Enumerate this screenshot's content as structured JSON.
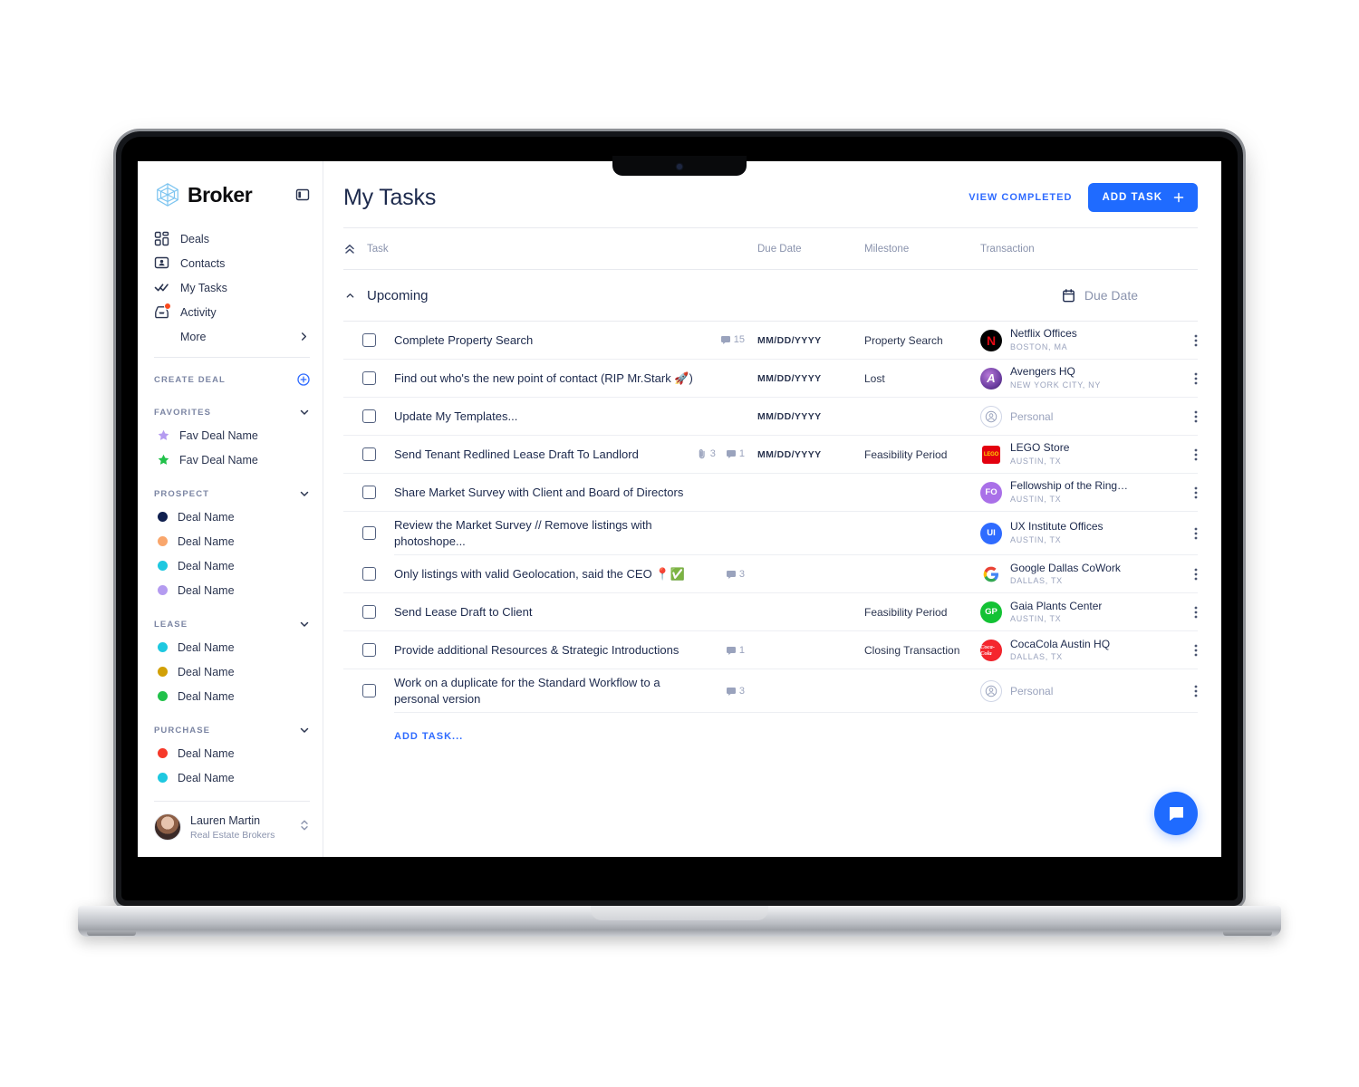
{
  "app": {
    "brand_name": "Broker",
    "logo_icon": "hexagon-cube-icon",
    "collapse_icon": "sidebar-collapse-icon"
  },
  "sidebar": {
    "nav": [
      {
        "label": "Deals",
        "icon": "grid-icon"
      },
      {
        "label": "Contacts",
        "icon": "contact-card-icon"
      },
      {
        "label": "My Tasks",
        "icon": "double-check-icon"
      },
      {
        "label": "Activity",
        "icon": "activity-inbox-icon",
        "badge": true
      },
      {
        "label": "More",
        "icon": "chevron-right-icon"
      }
    ],
    "sections": [
      {
        "label": "CREATE DEAL",
        "action_icon": "plus-circle-icon",
        "action_color": "#2f6bff",
        "items": []
      },
      {
        "label": "FAVORITES",
        "action_icon": "chevron-down-icon",
        "items": [
          {
            "label": "Fav Deal Name",
            "marker": "star",
            "color": "#b49bf0"
          },
          {
            "label": "Fav Deal Name",
            "marker": "star",
            "color": "#21c14a"
          }
        ]
      },
      {
        "label": "PROSPECT",
        "action_icon": "chevron-down-icon",
        "items": [
          {
            "label": "Deal Name",
            "marker": "dot",
            "color": "#10204f"
          },
          {
            "label": "Deal Name",
            "marker": "dot",
            "color": "#f9a66c"
          },
          {
            "label": "Deal Name",
            "marker": "dot",
            "color": "#1ec8e0"
          },
          {
            "label": "Deal Name",
            "marker": "dot",
            "color": "#b49bf0"
          }
        ]
      },
      {
        "label": "LEASE",
        "action_icon": "chevron-down-icon",
        "items": [
          {
            "label": "Deal Name",
            "marker": "dot",
            "color": "#1ec8e0"
          },
          {
            "label": "Deal Name",
            "marker": "dot",
            "color": "#d2a006"
          },
          {
            "label": "Deal Name",
            "marker": "dot",
            "color": "#21c14a"
          }
        ]
      },
      {
        "label": "PURCHASE",
        "action_icon": "chevron-down-icon",
        "items": [
          {
            "label": "Deal Name",
            "marker": "dot",
            "color": "#f6392a"
          },
          {
            "label": "Deal Name",
            "marker": "dot",
            "color": "#1ec8e0"
          }
        ]
      }
    ],
    "user": {
      "name": "Lauren Martin",
      "role": "Real Estate Brokers",
      "avatar_icon": "user-avatar-photo",
      "switch_icon": "chevron-up-down-icon"
    }
  },
  "header": {
    "title": "My Tasks",
    "view_completed_label": "VIEW COMPLETED",
    "add_task_label": "ADD TASK",
    "add_task_icon": "plus-icon",
    "accent_color": "#1f6bff"
  },
  "table": {
    "sort_icon": "sort-ascending-icon",
    "columns": {
      "task": "Task",
      "due_date": "Due Date",
      "milestone": "Milestone",
      "transaction": "Transaction"
    },
    "group": {
      "name": "Upcoming",
      "collapse_icon": "chevron-up-icon",
      "sort_label": "Due Date",
      "sort_icon": "calendar-icon"
    },
    "add_task_label": "ADD TASK...",
    "rows": [
      {
        "title": "Complete Property Search",
        "checkbox": "unchecked",
        "meta": [
          {
            "icon": "comment-icon",
            "count": "15"
          }
        ],
        "due_date": "MM/DD/YYYY",
        "milestone": "Property Search",
        "transaction": {
          "name": "Netflix Offices",
          "location": "BOSTON, MA",
          "logo": "netflix",
          "initials": "N",
          "bg": "#000000",
          "fg": "#e50914"
        },
        "menu_icon": "more-vertical-icon"
      },
      {
        "title": "Find out who's the new point of contact (RIP Mr.Stark 🚀)",
        "checkbox": "unchecked",
        "meta": [],
        "due_date": "MM/DD/YYYY",
        "milestone": "Lost",
        "transaction": {
          "name": "Avengers HQ",
          "location": "NEW YORK CITY, NY",
          "logo": "avengers",
          "initials": "A",
          "bg": "#6e3fa3",
          "fg": "#ffffff"
        },
        "menu_icon": "more-vertical-icon"
      },
      {
        "title": "Update My Templates...",
        "checkbox": "unchecked",
        "meta": [],
        "due_date": "MM/DD/YYYY",
        "milestone": "",
        "transaction": {
          "name": "Personal",
          "location": "",
          "logo": "personal",
          "initials": "",
          "bg": "#ffffff",
          "fg": "#9aa3bd"
        },
        "menu_icon": "more-vertical-icon"
      },
      {
        "title": "Send Tenant Redlined Lease Draft To Landlord",
        "checkbox": "unchecked",
        "meta": [
          {
            "icon": "attachment-icon",
            "count": "3"
          },
          {
            "icon": "comment-icon",
            "count": "1"
          }
        ],
        "due_date": "MM/DD/YYYY",
        "milestone": "Feasibility Period",
        "transaction": {
          "name": "LEGO Store",
          "location": "AUSTIN, TX",
          "logo": "lego",
          "initials": "",
          "bg": "#e3000f",
          "fg": "#ffd500"
        },
        "menu_icon": "more-vertical-icon"
      },
      {
        "title": "Share Market Survey with Client and Board of Directors",
        "checkbox": "unchecked",
        "meta": [],
        "due_date": "",
        "milestone": "",
        "transaction": {
          "name": "Fellowship of the Ring…",
          "location": "AUSTIN, TX",
          "logo": "initials",
          "initials": "FO",
          "bg": "#a970e8",
          "fg": "#ffffff"
        },
        "menu_icon": "more-vertical-icon"
      },
      {
        "title": "Review the Market Survey // Remove listings with photoshope...",
        "checkbox": "unchecked",
        "meta": [],
        "due_date": "",
        "milestone": "",
        "transaction": {
          "name": "UX Institute Offices",
          "location": "AUSTIN, TX",
          "logo": "initials",
          "initials": "UI",
          "bg": "#2f6bff",
          "fg": "#ffffff"
        },
        "menu_icon": "more-vertical-icon"
      },
      {
        "title": "Only listings with valid Geolocation, said the CEO 📍✅",
        "checkbox": "unchecked",
        "meta": [
          {
            "icon": "comment-icon",
            "count": "3"
          }
        ],
        "due_date": "",
        "milestone": "",
        "transaction": {
          "name": "Google Dallas CoWork",
          "location": "DALLAS, TX",
          "logo": "google",
          "initials": "G",
          "bg": "#ffffff",
          "fg": "#4285f4"
        },
        "menu_icon": "more-vertical-icon"
      },
      {
        "title": "Send Lease Draft to Client",
        "checkbox": "unchecked",
        "meta": [],
        "due_date": "",
        "milestone": "Feasibility Period",
        "transaction": {
          "name": "Gaia Plants Center",
          "location": "AUSTIN, TX",
          "logo": "initials",
          "initials": "GP",
          "bg": "#13c234",
          "fg": "#ffffff"
        },
        "menu_icon": "more-vertical-icon"
      },
      {
        "title": "Provide additional Resources & Strategic Introductions",
        "checkbox": "unchecked",
        "meta": [
          {
            "icon": "comment-icon",
            "count": "1"
          }
        ],
        "due_date": "",
        "milestone": "Closing Transaction",
        "transaction": {
          "name": "CocaCola Austin HQ",
          "location": "DALLAS, TX",
          "logo": "cocacola",
          "initials": "",
          "bg": "#e3000f",
          "fg": "#ffffff"
        },
        "menu_icon": "more-vertical-icon"
      },
      {
        "title": "Work on a duplicate for the Standard Workflow to a personal version",
        "checkbox": "unchecked",
        "meta": [
          {
            "icon": "comment-icon",
            "count": "3"
          }
        ],
        "due_date": "",
        "milestone": "",
        "transaction": {
          "name": "Personal",
          "location": "",
          "logo": "personal",
          "initials": "",
          "bg": "#ffffff",
          "fg": "#9aa3bd"
        },
        "menu_icon": "more-vertical-icon"
      }
    ]
  },
  "chat": {
    "icon": "chat-bubble-icon",
    "color": "#1f6bff"
  }
}
